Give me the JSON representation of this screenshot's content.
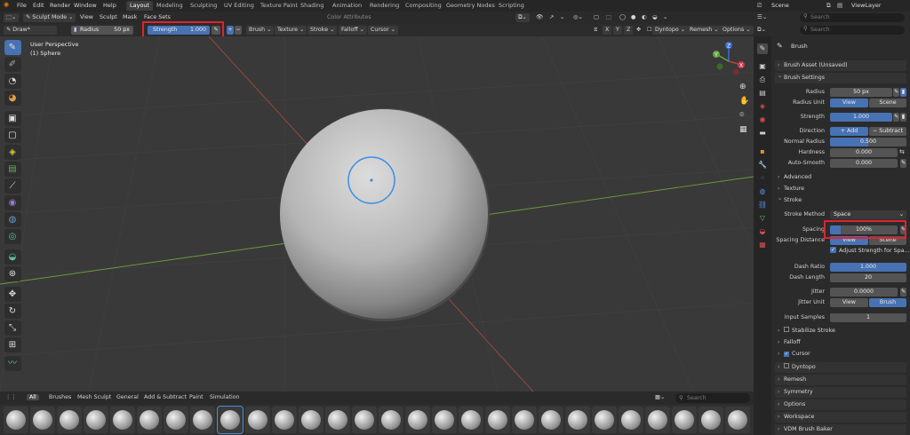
{
  "menu": [
    "File",
    "Edit",
    "Render",
    "Window",
    "Help"
  ],
  "workspaces": [
    {
      "label": "Layout",
      "active": true
    },
    {
      "label": "Modeling",
      "active": false
    },
    {
      "label": "Sculpting",
      "active": false
    },
    {
      "label": "UV Editing",
      "active": false
    },
    {
      "label": "Texture Paint",
      "active": false
    },
    {
      "label": "Shading",
      "active": false
    },
    {
      "label": "Animation",
      "active": false
    },
    {
      "label": "Rendering",
      "active": false
    },
    {
      "label": "Compositing",
      "active": false
    },
    {
      "label": "Geometry Nodes",
      "active": false
    },
    {
      "label": "Scripting",
      "active": false
    }
  ],
  "scene": {
    "label": "Scene",
    "view_layer": "ViewLayer"
  },
  "header": {
    "mode": "Sculpt Mode",
    "menus": [
      "View",
      "Sculpt",
      "Mask",
      "Face Sets"
    ],
    "color_attributes": "Color Attributes"
  },
  "tool_settings": {
    "brush_name": "Draw*",
    "radius_label": "Radius",
    "radius_value": "50 px",
    "strength_label": "Strength",
    "strength_value": "1.000",
    "menus": [
      "Brush",
      "Texture",
      "Stroke",
      "Falloff",
      "Cursor"
    ],
    "axes": [
      "X",
      "Y",
      "Z"
    ],
    "dyntopo": "Dyntopo",
    "remesh": "Remesh",
    "options": "Options"
  },
  "viewport": {
    "perspective": "User Perspective",
    "object": "(1) Sphere"
  },
  "gizmo": {
    "x": "X",
    "y": "Y",
    "z": "Z"
  },
  "shelf": {
    "tabs": [
      {
        "label": "All",
        "active": true
      },
      {
        "label": "Brushes",
        "active": false
      },
      {
        "label": "Mesh Sculpt",
        "active": false
      },
      {
        "label": "General",
        "active": false
      },
      {
        "label": "Add & Subtract",
        "active": false
      },
      {
        "label": "Paint",
        "active": false
      },
      {
        "label": "Simulation",
        "active": false
      }
    ],
    "search_placeholder": "Search"
  },
  "search": {
    "placeholder": "Search"
  },
  "properties": {
    "title": "Brush",
    "brush_asset": "Brush Asset (Unsaved)",
    "brush_settings": "Brush Settings",
    "radius_label": "Radius",
    "radius_value": "50 px",
    "radius_unit_label": "Radius Unit",
    "radius_unit_view": "View",
    "radius_unit_scene": "Scene",
    "strength_label": "Strength",
    "strength_value": "1.000",
    "direction_label": "Direction",
    "direction_add": "Add",
    "direction_subtract": "Subtract",
    "normal_radius_label": "Normal Radius",
    "normal_radius_value": "0.500",
    "hardness_label": "Hardness",
    "hardness_value": "0.000",
    "auto_smooth_label": "Auto-Smooth",
    "auto_smooth_value": "0.000",
    "advanced": "Advanced",
    "texture": "Texture",
    "stroke": "Stroke",
    "stroke_method_label": "Stroke Method",
    "stroke_method_value": "Space",
    "spacing_label": "Spacing",
    "spacing_value": "100%",
    "spacing_distance_label": "Spacing Distance",
    "spacing_distance_view": "View",
    "spacing_distance_scene": "Scene",
    "adjust_strength": "Adjust Strength for Spa...",
    "dash_ratio_label": "Dash Ratio",
    "dash_ratio_value": "1.000",
    "dash_length_label": "Dash Length",
    "dash_length_value": "20",
    "jitter_label": "Jitter",
    "jitter_value": "0.0000",
    "jitter_unit_label": "Jitter Unit",
    "jitter_unit_view": "View",
    "jitter_unit_brush": "Brush",
    "input_samples_label": "Input Samples",
    "input_samples_value": "1",
    "stabilize_stroke": "Stabilize Stroke",
    "falloff": "Falloff",
    "cursor": "Cursor",
    "dyntopo": "Dyntopo",
    "remesh": "Remesh",
    "symmetry": "Symmetry",
    "options": "Options",
    "workspace": "Workspace",
    "vdm_brush_baker": "VDM Brush Baker"
  },
  "colors": {
    "accent": "#4772b3",
    "highlight": "#e0232e",
    "x_axis": "#a5483e",
    "y_axis": "#6e9a3a",
    "cursor": "#3a8ee6"
  }
}
